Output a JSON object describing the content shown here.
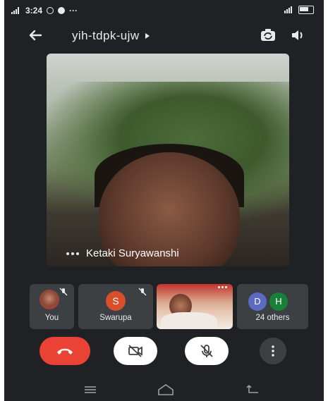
{
  "status_bar": {
    "time": "3:24",
    "more": "···"
  },
  "header": {
    "meeting_code": "yih-tdpk-ujw"
  },
  "main_video": {
    "participant_name": "Ketaki Suryawanshi"
  },
  "participants": [
    {
      "label": "You"
    },
    {
      "label": "Swarupa",
      "avatar_letter": "S"
    },
    {
      "label": ""
    },
    {
      "label": "24 others",
      "avatar_letters": [
        "D",
        "H"
      ]
    }
  ],
  "colors": {
    "background": "#202124",
    "end_call": "#ea4335",
    "tile": "#3c4043"
  },
  "icons": {
    "back": "back-arrow-icon",
    "camera_switch": "camera-switch-icon",
    "speaker": "speaker-icon",
    "end_call": "end-call-icon",
    "camera_off": "camera-off-icon",
    "mic_off": "mic-off-icon",
    "more": "more-vert-icon"
  }
}
